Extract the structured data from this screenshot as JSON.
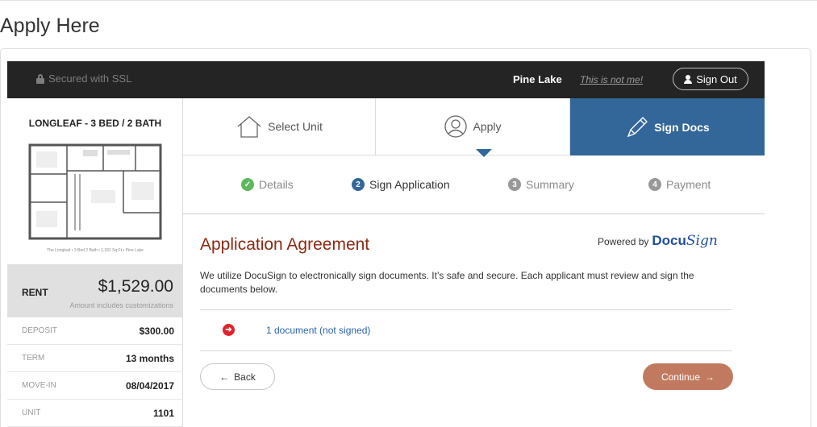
{
  "page": {
    "title": "Apply Here"
  },
  "header": {
    "ssl_text": "Secured with SSL",
    "community": "Pine Lake",
    "not_me": "This is not me!",
    "sign_out": "Sign Out"
  },
  "unit": {
    "title": "LONGLEAF - 3 BED / 2 BATH",
    "floorplan_caption": "The Longleaf • 3 Bed 2 Bath • 1,331 Sq Ft • Pine Lake",
    "rent_label": "RENT",
    "rent_value": "$1,529.00",
    "rent_note": "Amount includes customizations",
    "details": [
      {
        "key": "DEPOSIT",
        "value": "$300.00"
      },
      {
        "key": "TERM",
        "value": "13 months"
      },
      {
        "key": "MOVE-IN",
        "value": "08/04/2017"
      },
      {
        "key": "UNIT",
        "value": "1101"
      }
    ]
  },
  "tabs": [
    {
      "label": "Select Unit",
      "icon": "house-icon",
      "active": false
    },
    {
      "label": "Apply",
      "icon": "user-circle-icon",
      "active": false
    },
    {
      "label": "Sign Docs",
      "icon": "pencil-icon",
      "active": true
    }
  ],
  "substeps": [
    {
      "num": "✓",
      "label": "Details",
      "state": "done"
    },
    {
      "num": "2",
      "label": "Sign Application",
      "state": "current"
    },
    {
      "num": "3",
      "label": "Summary",
      "state": "pending"
    },
    {
      "num": "4",
      "label": "Payment",
      "state": "pending"
    }
  ],
  "main": {
    "title": "Application Agreement",
    "powered_by": "Powered by",
    "brand_a": "Docu",
    "brand_b": "Sign",
    "description": "We utilize DocuSign to electronically sign documents. It’s safe and secure. Each applicant must review and sign the documents below.",
    "document_link": "1 document (not signed)",
    "back_label": "Back",
    "continue_label": "Continue"
  },
  "colors": {
    "accent_blue": "#336699",
    "title_red": "#8b2a12",
    "continue_btn": "#c17a5f",
    "done_green": "#5cb85c"
  }
}
